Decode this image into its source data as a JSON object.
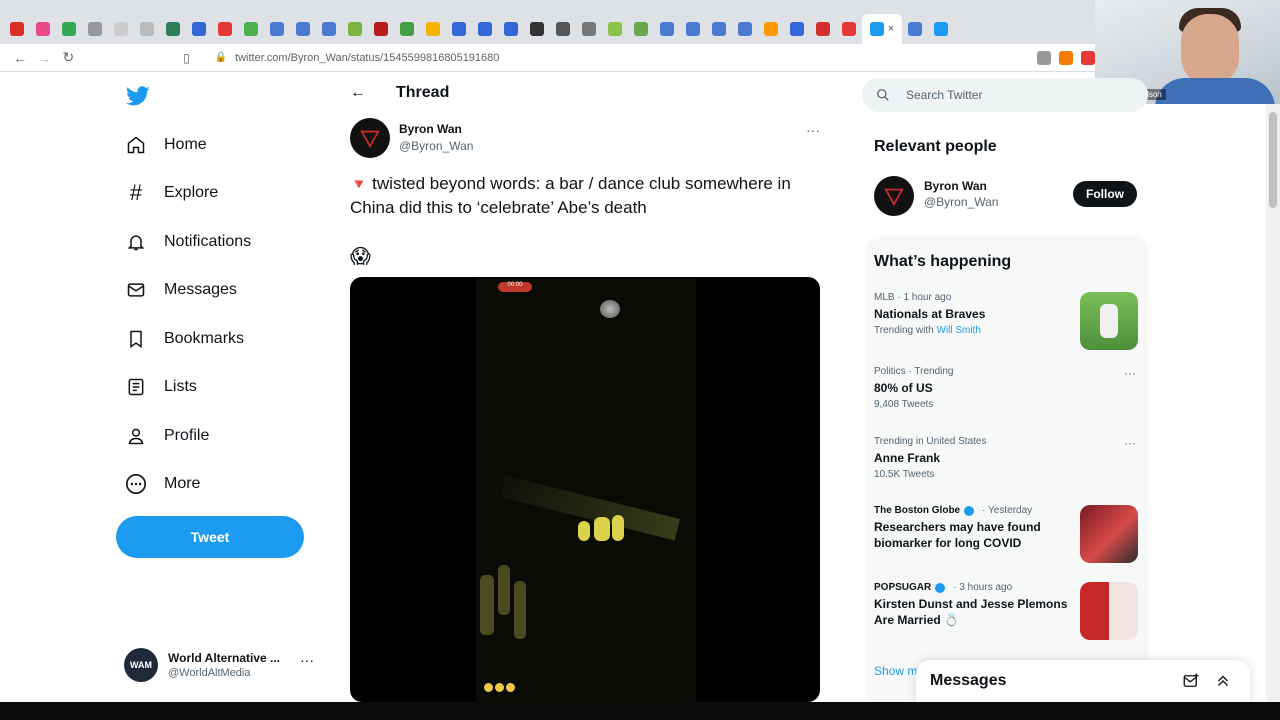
{
  "browser": {
    "url": "twitter.com/Byron_Wan/status/1545599816805191680",
    "tab_colors": [
      "#d93025",
      "#e84c88",
      "#34a853",
      "#999999",
      "#cccccc",
      "#bbbbbb",
      "#2e7d5b",
      "#3367d6",
      "#e53935",
      "#4caf50",
      "#4a7bd0",
      "#4a7bd0",
      "#4a7bd0",
      "#7cb342",
      "#b71c1c",
      "#43a047",
      "#f4b400",
      "#3367d6",
      "#3367d6",
      "#3367d6",
      "#333333",
      "#555555",
      "#777777",
      "#8bc34a",
      "#6aa84f",
      "#4a7bd0",
      "#4a7bd0",
      "#4a7bd0",
      "#4a7bd0",
      "#ff9800",
      "#3367d6",
      "#d32f2f",
      "#e53935",
      "#1d9bf0",
      "#4a7bd0",
      "#1d9bf0"
    ],
    "ext_colors": [
      "#999999",
      "#f57c00",
      "#e53935"
    ]
  },
  "webcam": {
    "caption": "Jonah Edgardson"
  },
  "sidebar": {
    "items": [
      {
        "label": "Home",
        "icon": "home-icon"
      },
      {
        "label": "Explore",
        "icon": "hashtag-icon"
      },
      {
        "label": "Notifications",
        "icon": "bell-icon"
      },
      {
        "label": "Messages",
        "icon": "envelope-icon"
      },
      {
        "label": "Bookmarks",
        "icon": "bookmark-icon"
      },
      {
        "label": "Lists",
        "icon": "list-icon"
      },
      {
        "label": "Profile",
        "icon": "person-icon"
      },
      {
        "label": "More",
        "icon": "more-circle-icon"
      }
    ],
    "tweet_label": "Tweet",
    "account": {
      "initials": "WAM",
      "name": "World Alternative ...",
      "handle": "@WorldAltMedia"
    }
  },
  "thread": {
    "title": "Thread",
    "author": {
      "name": "Byron Wan",
      "handle": "@Byron_Wan"
    },
    "text": "twisted beyond words: a bar / dance club somewhere in China did this to ‘celebrate’ Abe’s death",
    "emoji": "😱",
    "video": {
      "rec_label": "00:00"
    }
  },
  "right": {
    "search_placeholder": "Search Twitter",
    "relevant_title": "Relevant people",
    "relevant_person": {
      "name": "Byron Wan",
      "handle": "@Byron_Wan",
      "follow_label": "Follow"
    },
    "happening_title": "What’s happening",
    "trends": [
      {
        "meta": "MLB · 1 hour ago",
        "title": "Nationals at Braves",
        "sub_prefix": "Trending with ",
        "sub_link": "Will Smith",
        "thumb": "#6aa84f"
      },
      {
        "meta": "Politics · Trending",
        "title": "80% of US",
        "sub": "9,408 Tweets"
      },
      {
        "meta": "Trending in United States",
        "title": "Anne Frank",
        "sub": "10.5K Tweets"
      },
      {
        "source": "The Boston Globe",
        "time": "· Yesterday",
        "title": "Researchers may have found biomarker for long COVID",
        "thumb": "#b3263a"
      },
      {
        "source": "POPSUGAR",
        "time": "· 3 hours ago",
        "title": "Kirsten Dunst and Jesse Plemons Are Married 💍",
        "thumb": "#c62828"
      }
    ],
    "show_more": "Show more"
  },
  "messages_drawer": {
    "title": "Messages"
  }
}
